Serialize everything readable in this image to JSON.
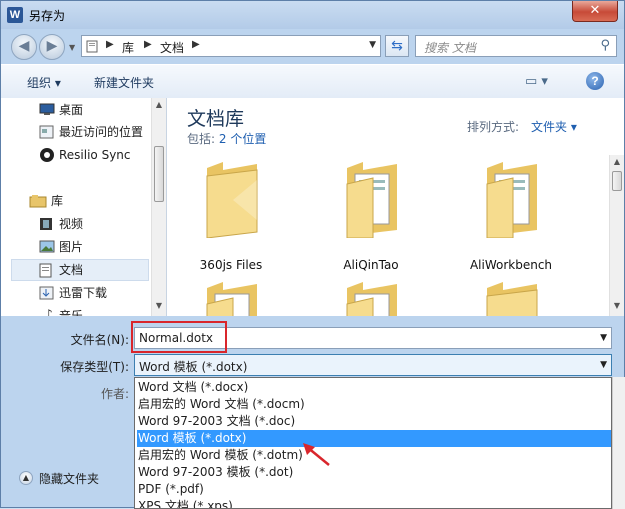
{
  "window": {
    "title": "另存为",
    "app_icon": "W",
    "close": "✕"
  },
  "address": {
    "crumbs": [
      "库",
      "文档"
    ]
  },
  "search": {
    "placeholder": "搜索 文档"
  },
  "toolbar": {
    "organize": "组织 ▾",
    "new_folder": "新建文件夹"
  },
  "nav": {
    "items": [
      {
        "label": "桌面",
        "icon": "desktop-icon"
      },
      {
        "label": "最近访问的位置",
        "icon": "recent-places-icon"
      },
      {
        "label": "Resilio Sync",
        "icon": "resilio-sync-icon"
      },
      {
        "label": "库",
        "icon": "library-icon"
      },
      {
        "label": "视频",
        "icon": "video-icon"
      },
      {
        "label": "图片",
        "icon": "pictures-icon"
      },
      {
        "label": "文档",
        "icon": "documents-icon",
        "selected": true
      },
      {
        "label": "迅雷下载",
        "icon": "download-icon"
      },
      {
        "label": "音乐",
        "icon": "music-icon"
      }
    ]
  },
  "content": {
    "title": "文档库",
    "includes_label": "包括:",
    "includes_link": "2 个位置",
    "sort_label": "排列方式:",
    "sort_value": "文件夹 ▾",
    "folders": [
      "360js Files",
      "AliQinTao",
      "AliWorkbench",
      "",
      "",
      ""
    ]
  },
  "form": {
    "filename_label": "文件名(N):",
    "filename_value": "Normal.dotx",
    "type_label": "保存类型(T):",
    "type_value": "Word 模板 (*.dotx)",
    "author_label": "作者:",
    "hide_folders": "隐藏文件夹"
  },
  "type_options": [
    "Word 文档 (*.docx)",
    "启用宏的 Word 文档 (*.docm)",
    "Word 97-2003 文档 (*.doc)",
    "Word 模板 (*.dotx)",
    "启用宏的 Word 模板 (*.dotm)",
    "Word 97-2003 模板 (*.dot)",
    "PDF (*.pdf)",
    "XPS 文档 (*.xps)"
  ],
  "selected_type_index": 3,
  "colors": {
    "selection": "#3399ff",
    "annotation": "#d9262c",
    "folder": "#f3d27a"
  }
}
